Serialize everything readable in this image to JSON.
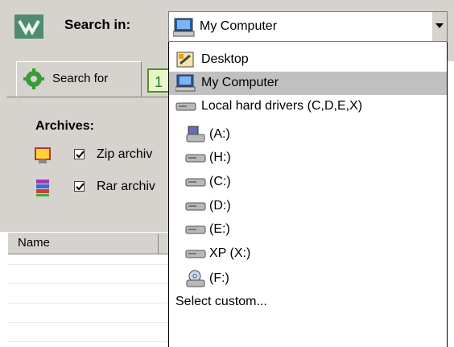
{
  "toolbar": {
    "search_in_label": "Search in:",
    "selected_location": "My Computer"
  },
  "tabs": {
    "search_for_label": "Search for",
    "date_tab_glyph": "1"
  },
  "archives": {
    "heading": "Archives:",
    "items": [
      {
        "label": "Zip archiv",
        "checked": true,
        "icon": "zip-archive-icon"
      },
      {
        "label": "Rar archiv",
        "checked": true,
        "icon": "rar-archive-icon"
      }
    ]
  },
  "results_table": {
    "columns": [
      "Name"
    ]
  },
  "location_dropdown": {
    "options": [
      {
        "label": "Desktop",
        "icon": "desktop-icon",
        "level": 0
      },
      {
        "label": "My Computer",
        "icon": "computer-icon",
        "level": 0,
        "selected": true
      },
      {
        "label": "Local hard drivers (C,D,E,X)",
        "icon": "drive-icon",
        "level": 0
      },
      {
        "label": "(A:)",
        "icon": "floppy-drive-icon",
        "level": 1
      },
      {
        "label": "(H:)",
        "icon": "drive-icon",
        "level": 1
      },
      {
        "label": "(C:)",
        "icon": "drive-icon",
        "level": 1
      },
      {
        "label": "(D:)",
        "icon": "drive-icon",
        "level": 1
      },
      {
        "label": "(E:)",
        "icon": "drive-icon",
        "level": 1
      },
      {
        "label": "XP (X:)",
        "icon": "drive-icon",
        "level": 1
      },
      {
        "label": "(F:)",
        "icon": "cd-drive-icon",
        "level": 1
      },
      {
        "label": "Select custom...",
        "icon": "",
        "level": 0
      }
    ]
  },
  "colors": {
    "panel": "#d6d3ce",
    "selection": "#c0c0c0"
  }
}
